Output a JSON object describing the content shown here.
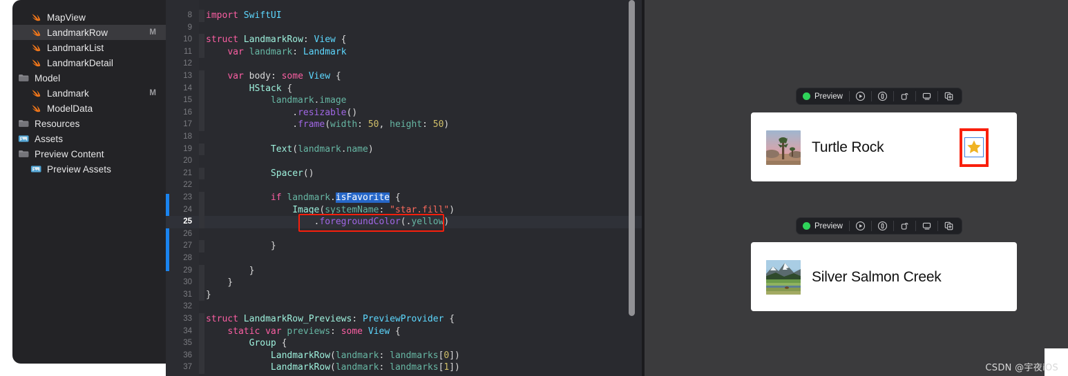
{
  "app": {
    "name": "Xcode",
    "watermark": "CSDN @宇夜iOS"
  },
  "navigator": {
    "items": [
      {
        "label": "MapView",
        "icon": "swift-file-icon",
        "indent": 1,
        "badge": "",
        "selected": false
      },
      {
        "label": "LandmarkRow",
        "icon": "swift-file-icon",
        "indent": 1,
        "badge": "M",
        "selected": true
      },
      {
        "label": "LandmarkList",
        "icon": "swift-file-icon",
        "indent": 1,
        "badge": "",
        "selected": false
      },
      {
        "label": "LandmarkDetail",
        "icon": "swift-file-icon",
        "indent": 1,
        "badge": "",
        "selected": false
      },
      {
        "label": "Model",
        "icon": "folder-icon",
        "indent": 0,
        "badge": "",
        "selected": false
      },
      {
        "label": "Landmark",
        "icon": "swift-file-icon",
        "indent": 1,
        "badge": "M",
        "selected": false
      },
      {
        "label": "ModelData",
        "icon": "swift-file-icon",
        "indent": 1,
        "badge": "",
        "selected": false
      },
      {
        "label": "Resources",
        "icon": "folder-icon",
        "indent": 0,
        "badge": "",
        "selected": false
      },
      {
        "label": "Assets",
        "icon": "assets-catalog-icon",
        "indent": 0,
        "badge": "",
        "selected": false
      },
      {
        "label": "Preview Content",
        "icon": "folder-icon",
        "indent": 0,
        "badge": "",
        "selected": false
      },
      {
        "label": "Preview Assets",
        "icon": "assets-catalog-icon",
        "indent": 1,
        "badge": "",
        "selected": false
      }
    ]
  },
  "editor": {
    "first_line": 8,
    "current_line": 25,
    "selection_token": "isFavorite",
    "change_bar_lines": [
      23,
      28
    ],
    "lines": [
      {
        "n": 8,
        "text": "import SwiftUI"
      },
      {
        "n": 9,
        "text": ""
      },
      {
        "n": 10,
        "text": "struct LandmarkRow: View {"
      },
      {
        "n": 11,
        "text": "    var landmark: Landmark"
      },
      {
        "n": 12,
        "text": ""
      },
      {
        "n": 13,
        "text": "    var body: some View {"
      },
      {
        "n": 14,
        "text": "        HStack {"
      },
      {
        "n": 15,
        "text": "            landmark.image"
      },
      {
        "n": 16,
        "text": "                .resizable()"
      },
      {
        "n": 17,
        "text": "                .frame(width: 50, height: 50)"
      },
      {
        "n": 18,
        "text": ""
      },
      {
        "n": 19,
        "text": "            Text(landmark.name)"
      },
      {
        "n": 20,
        "text": ""
      },
      {
        "n": 21,
        "text": "            Spacer()"
      },
      {
        "n": 22,
        "text": ""
      },
      {
        "n": 23,
        "text": "            if landmark.isFavorite {"
      },
      {
        "n": 24,
        "text": "                Image(systemName: \"star.fill\")"
      },
      {
        "n": 25,
        "text": "                    .foregroundColor(.yellow)"
      },
      {
        "n": 26,
        "text": ""
      },
      {
        "n": 27,
        "text": "            }"
      },
      {
        "n": 28,
        "text": ""
      },
      {
        "n": 29,
        "text": "        }"
      },
      {
        "n": 30,
        "text": "    }"
      },
      {
        "n": 31,
        "text": "}"
      },
      {
        "n": 32,
        "text": ""
      },
      {
        "n": 33,
        "text": "struct LandmarkRow_Previews: PreviewProvider {"
      },
      {
        "n": 34,
        "text": "    static var previews: some View {"
      },
      {
        "n": 35,
        "text": "        Group {"
      },
      {
        "n": 36,
        "text": "            LandmarkRow(landmark: landmarks[0])"
      },
      {
        "n": 37,
        "text": "            LandmarkRow(landmark: landmarks[1])"
      }
    ]
  },
  "preview": {
    "toolbar": {
      "status_label": "Preview",
      "status_color": "#2fd35a",
      "buttons": [
        "play-preview-icon",
        "live-preview-icon",
        "device-rotate-icon",
        "preview-on-device-icon",
        "duplicate-preview-icon"
      ]
    },
    "rows": [
      {
        "title": "Turtle Rock",
        "thumbnail": "joshua-tree-desert-thumbnail",
        "favorite": true,
        "star_color": "#f0b323"
      },
      {
        "title": "Silver Salmon Creek",
        "thumbnail": "snowy-mountain-meadow-thumbnail",
        "favorite": false,
        "star_color": ""
      }
    ]
  },
  "annotations": {
    "code_highlight_line": 25,
    "code_highlight_color": "#f91f0c",
    "star_highlight_color": "#f91f0c"
  }
}
